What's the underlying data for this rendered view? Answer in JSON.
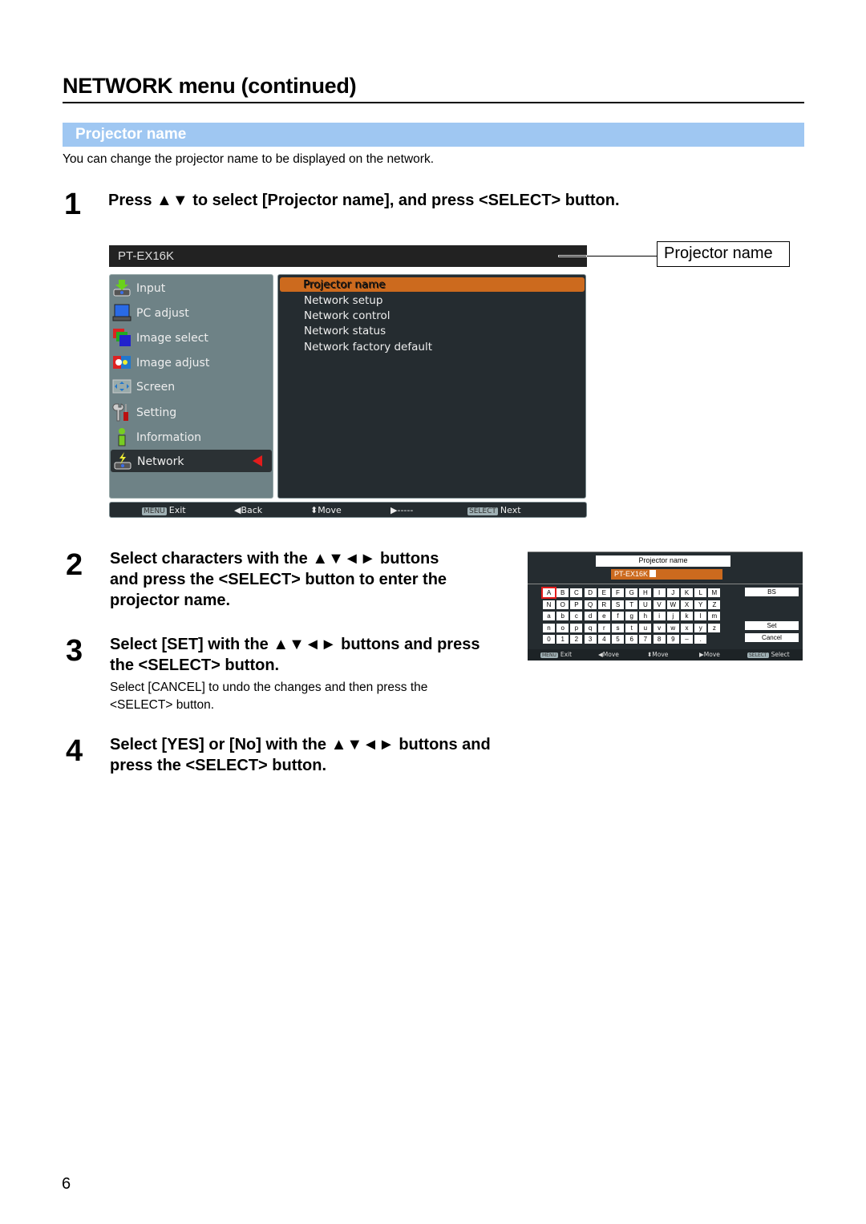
{
  "header": {
    "title": "NETWORK menu (continued)"
  },
  "section": {
    "title": "Projector name",
    "intro": "You can change the projector name to be displayed on the network."
  },
  "steps": [
    {
      "number": "1",
      "text": "Press ▲▼ to select [Projector name], and press <SELECT> button."
    },
    {
      "number": "2",
      "lines": [
        "Select characters with the ▲▼◄► buttons",
        "and press the <SELECT> button to enter the",
        "projector name."
      ]
    },
    {
      "number": "3",
      "lines": [
        "Select [SET] with the ▲▼◄► buttons and press",
        "the <SELECT> button."
      ],
      "note_lines": [
        "Select [CANCEL] to undo the changes and then press the",
        "<SELECT> button."
      ]
    },
    {
      "number": "4",
      "lines": [
        "Select [YES] or [No] with the ▲▼◄► buttons and",
        "press the <SELECT> button."
      ]
    }
  ],
  "osd_menu": {
    "model": "PT-EX16K",
    "callout": "Projector name",
    "main_items": [
      {
        "label": "Input",
        "icon": "input-icon"
      },
      {
        "label": "PC adjust",
        "icon": "pc-adjust-icon"
      },
      {
        "label": "Image select",
        "icon": "image-select-icon"
      },
      {
        "label": "Image adjust",
        "icon": "image-adjust-icon"
      },
      {
        "label": "Screen",
        "icon": "screen-icon"
      },
      {
        "label": "Setting",
        "icon": "setting-icon"
      },
      {
        "label": "Information",
        "icon": "information-icon"
      },
      {
        "label": "Network",
        "icon": "network-icon",
        "selected": true
      }
    ],
    "sub_items": [
      {
        "label": "Projector name",
        "selected": true
      },
      {
        "label": "Network setup"
      },
      {
        "label": "Network control"
      },
      {
        "label": "Network status"
      },
      {
        "label": "Network factory default"
      }
    ],
    "footer": {
      "exit_key": "MENU",
      "exit": "Exit",
      "back": "Back",
      "move": "Move",
      "right": "-----",
      "select_key": "SELECT",
      "next": "Next"
    }
  },
  "osd_keyboard": {
    "title": "Projector name",
    "value": "PT-EX16K",
    "rows": [
      [
        "A",
        "B",
        "C",
        "D",
        "E",
        "F",
        "G",
        "H",
        "I",
        "J",
        "K",
        "L",
        "M"
      ],
      [
        "N",
        "O",
        "P",
        "Q",
        "R",
        "S",
        "T",
        "U",
        "V",
        "W",
        "X",
        "Y",
        "Z"
      ],
      [
        "a",
        "b",
        "c",
        "d",
        "e",
        "f",
        "g",
        "h",
        "i",
        "j",
        "k",
        "l",
        "m"
      ],
      [
        "n",
        "o",
        "p",
        "q",
        "r",
        "s",
        "t",
        "u",
        "v",
        "w",
        "x",
        "y",
        "z"
      ],
      [
        "0",
        "1",
        "2",
        "3",
        "4",
        "5",
        "6",
        "7",
        "8",
        "9",
        "–",
        "."
      ]
    ],
    "active_key": "A",
    "bs": "BS",
    "set": "Set",
    "cancel": "Cancel",
    "footer": {
      "exit_key": "MENU",
      "exit": "Exit",
      "left": "Move",
      "updown": "Move",
      "right": "Move",
      "select_key": "SELECT",
      "select": "Select"
    }
  },
  "page_number": "6"
}
